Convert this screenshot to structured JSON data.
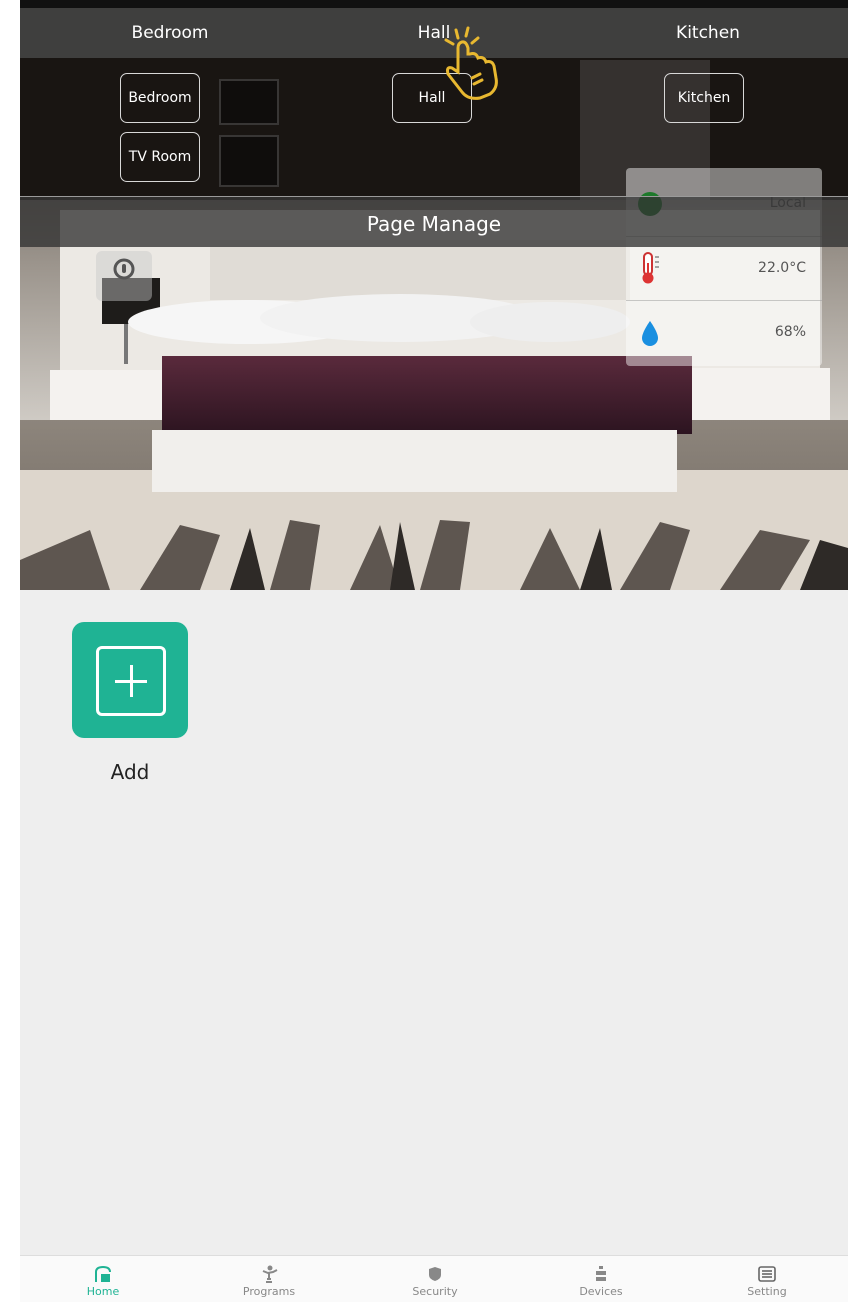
{
  "room_tabs": [
    {
      "label": "Bedroom"
    },
    {
      "label": "Hall"
    },
    {
      "label": "Kitchen"
    }
  ],
  "room_buttons": [
    {
      "label": "Bedroom"
    },
    {
      "label": "TV Room"
    },
    {
      "label": "Hall"
    },
    {
      "label": "Kitchen"
    }
  ],
  "page_manage_title": "Page Manage",
  "sensors": {
    "connection": "Local",
    "temperature": "22.0°C",
    "humidity": "68%"
  },
  "add_tile": {
    "label": "Add",
    "icon": "plus-square-icon"
  },
  "nav": [
    {
      "label": "Home",
      "icon": "home-icon",
      "active": true
    },
    {
      "label": "Programs",
      "icon": "programs-icon",
      "active": false
    },
    {
      "label": "Security",
      "icon": "shield-icon",
      "active": false
    },
    {
      "label": "Devices",
      "icon": "devices-icon",
      "active": false
    },
    {
      "label": "Setting",
      "icon": "list-icon",
      "active": false
    }
  ],
  "colors": {
    "accent": "#1fb394",
    "nav_inactive": "#888888",
    "background": "#eeeeee",
    "bedspread": "#4a1f30"
  }
}
